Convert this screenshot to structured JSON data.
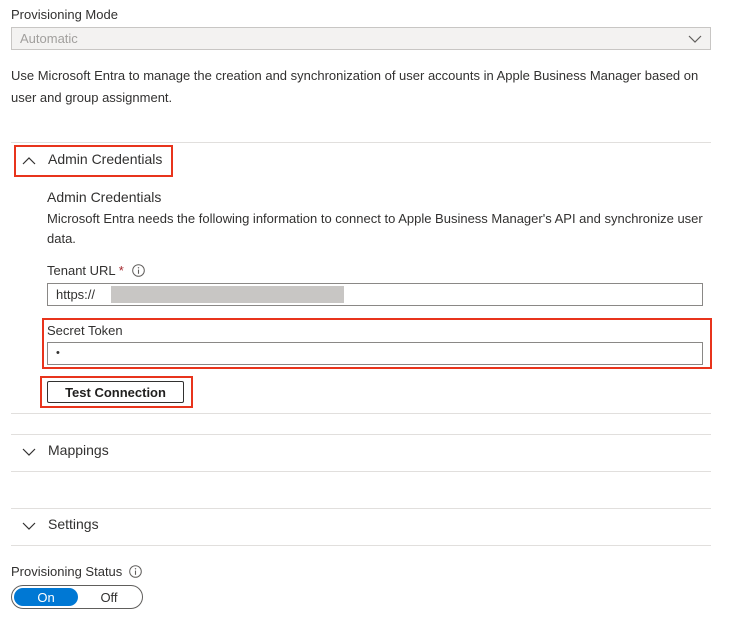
{
  "provisioning_mode": {
    "label": "Provisioning Mode",
    "value": "Automatic",
    "description": "Use Microsoft Entra to manage the creation and synchronization of user accounts in Apple Business Manager based on user and group assignment."
  },
  "admin_credentials": {
    "header": "Admin Credentials",
    "subtitle": "Admin Credentials",
    "description": "Microsoft Entra needs the following information to connect to Apple Business Manager's API and synchronize user data.",
    "tenant_url": {
      "label": "Tenant URL",
      "required_mark": "*",
      "value": "https://"
    },
    "secret_token": {
      "label": "Secret Token",
      "value": "•"
    },
    "test_connection_label": "Test Connection"
  },
  "mappings": {
    "header": "Mappings"
  },
  "settings": {
    "header": "Settings"
  },
  "provisioning_status": {
    "label": "Provisioning Status",
    "on_label": "On",
    "off_label": "Off",
    "selected": "On"
  },
  "colors": {
    "highlight": "#e8341c",
    "accent": "#0078d4",
    "required": "#a4262c"
  },
  "icons": {
    "dropdown": "chevron-down-icon",
    "expanded": "chevron-up-icon",
    "collapsed": "chevron-down-icon",
    "info": "info-icon"
  }
}
